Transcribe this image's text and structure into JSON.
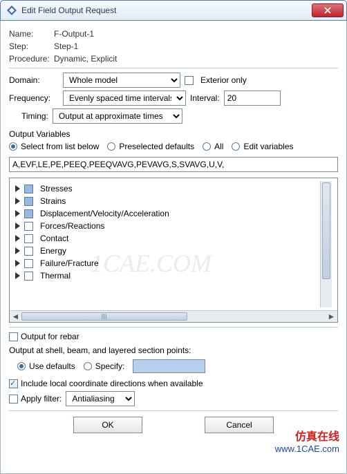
{
  "title": "Edit Field Output Request",
  "fields": {
    "name_label": "Name:",
    "name_value": "F-Output-1",
    "step_label": "Step:",
    "step_value": "Step-1",
    "procedure_label": "Procedure:",
    "procedure_value": "Dynamic, Explicit"
  },
  "domain": {
    "label": "Domain:",
    "value": "Whole model",
    "exterior_label": "Exterior only"
  },
  "frequency": {
    "label": "Frequency:",
    "value": "Evenly spaced time intervals",
    "interval_label": "Interval:",
    "interval_value": "20"
  },
  "timing": {
    "label": "Timing:",
    "value": "Output at approximate times"
  },
  "output_vars": {
    "title": "Output Variables",
    "radios": {
      "select": "Select from list below",
      "preselected": "Preselected defaults",
      "all": "All",
      "edit": "Edit variables"
    },
    "text": "A,EVF,LE,PE,PEEQ,PEEQVAVG,PEVAVG,S,SVAVG,U,V,"
  },
  "tree": [
    {
      "label": "Stresses",
      "checked": true
    },
    {
      "label": "Strains",
      "checked": true
    },
    {
      "label": "Displacement/Velocity/Acceleration",
      "checked": true
    },
    {
      "label": "Forces/Reactions",
      "checked": false
    },
    {
      "label": "Contact",
      "checked": false
    },
    {
      "label": "Energy",
      "checked": false
    },
    {
      "label": "Failure/Fracture",
      "checked": false
    },
    {
      "label": "Thermal",
      "checked": false
    }
  ],
  "bottom": {
    "rebar": "Output for rebar",
    "section_points": "Output at shell, beam, and layered section points:",
    "use_defaults": "Use defaults",
    "specify": "Specify:",
    "local_coord": "Include local coordinate directions when available",
    "apply_filter": "Apply filter:",
    "filter_value": "Antialiasing"
  },
  "buttons": {
    "ok": "OK",
    "cancel": "Cancel"
  },
  "watermark": {
    "w1": "1CAE.COM",
    "w2a": "仿真在线",
    "w2b": "www.1CAE.com"
  }
}
